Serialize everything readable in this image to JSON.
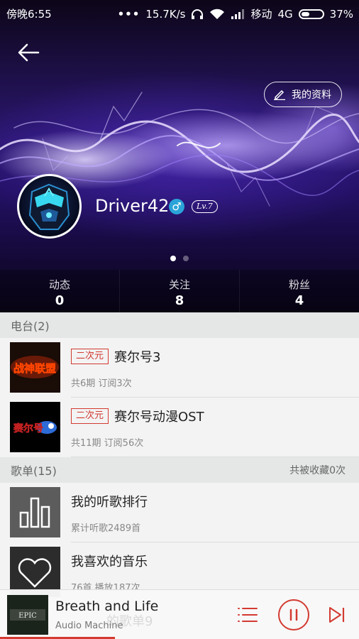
{
  "status_bar": {
    "time": "傍晚6:55",
    "dots": "•••",
    "speed": "15.7K/s",
    "carrier": "移动",
    "network": "4G",
    "battery": "37%"
  },
  "header": {
    "profile_button_label": "我的资料",
    "username": "Driver42",
    "gender_symbol": "♂",
    "level": "Lv.7"
  },
  "stats": [
    {
      "label": "动态",
      "value": "0"
    },
    {
      "label": "关注",
      "value": "8"
    },
    {
      "label": "粉丝",
      "value": "4"
    }
  ],
  "radio_section": {
    "title": "电台(2)",
    "items": [
      {
        "tag": "二次元",
        "title": "赛尔号3",
        "meta": "共6期 订阅3次",
        "thumb_text": "战神联盟"
      },
      {
        "tag": "二次元",
        "title": "赛尔号动漫OST",
        "meta": "共11期 订阅56次",
        "thumb_text": "赛尔号"
      }
    ]
  },
  "playlist_section": {
    "title": "歌单(15)",
    "collected": "共被收藏0次",
    "items": [
      {
        "title": "我的听歌排行",
        "meta": "累计听歌2489首"
      },
      {
        "title": "我喜欢的音乐",
        "meta": "76首 播放187次"
      }
    ]
  },
  "player": {
    "track": "Breath and Life",
    "artist": "Audio Machine",
    "background_text": "的歌单9",
    "cover_text": "EPIC",
    "progress": 0.32
  },
  "colors": {
    "accent": "#d33a31",
    "gender_badge": "#2aa3d8"
  }
}
